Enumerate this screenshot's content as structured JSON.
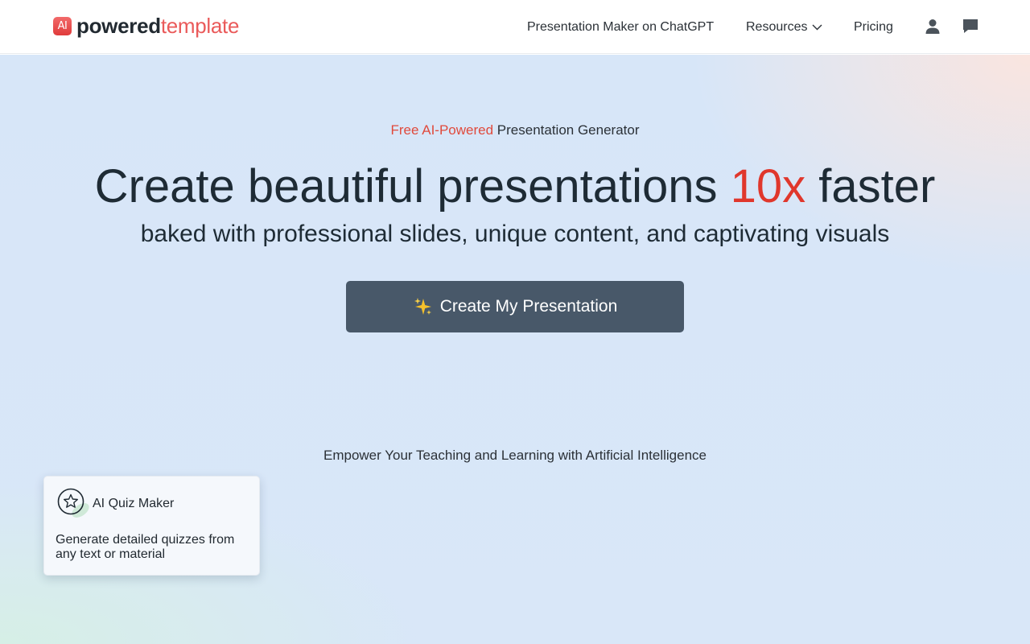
{
  "header": {
    "logo_badge": "AI",
    "logo_bold": "powered",
    "logo_light": "template",
    "nav": {
      "chatgpt": "Presentation Maker on ChatGPT",
      "resources": "Resources",
      "pricing": "Pricing"
    },
    "icons": [
      "user-icon",
      "chat-icon",
      "chevron-down-icon"
    ]
  },
  "hero": {
    "eyebrow_accent": "Free AI-Powered",
    "eyebrow_rest": "Presentation Generator",
    "headline_start": "Create beautiful presentations ",
    "headline_accent": "10x",
    "headline_end": " faster",
    "subheadline": "baked with professional slides, unique content, and captivating visuals",
    "cta_label": "Create My Presentation",
    "cta_icon": "sparkles-icon",
    "empower": "Empower Your Teaching and Learning with Artificial Intelligence"
  },
  "cards": [
    {
      "title": "AI Quiz Maker",
      "description": "Generate detailed quizzes from any text or material",
      "icon": "star-badge-icon"
    }
  ],
  "colors": {
    "accent_red": "#e0372c",
    "cta_bg": "#485869",
    "hero_bg": "#d9e7f8",
    "text_dark": "#1e2b35"
  }
}
